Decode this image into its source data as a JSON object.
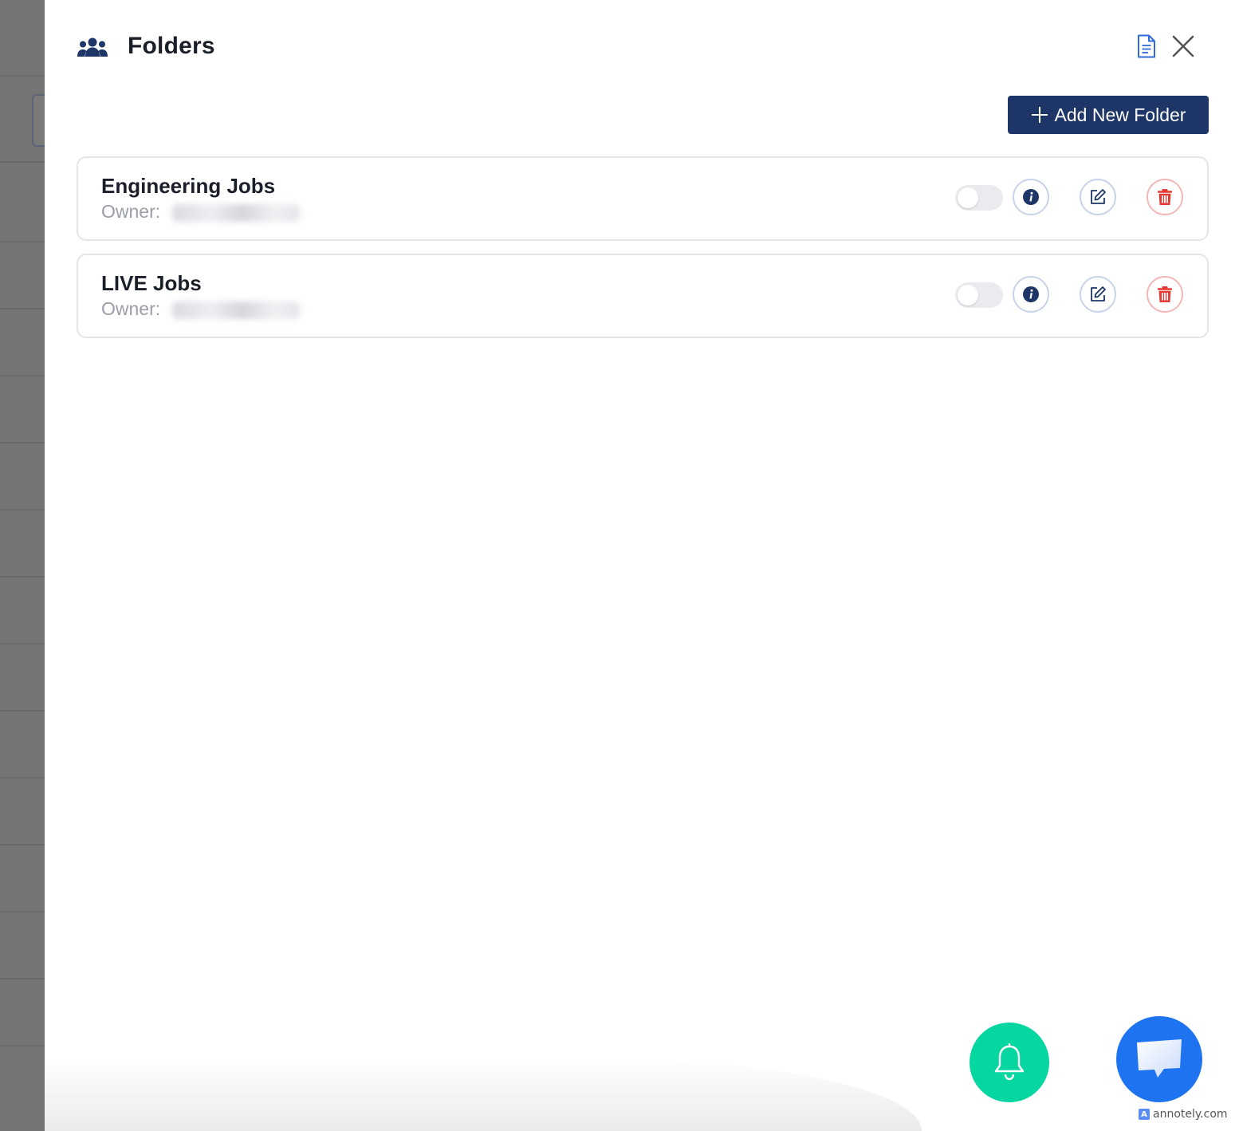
{
  "header": {
    "title": "Folders",
    "icon": "team-icon",
    "doc_icon": "document-icon",
    "close_icon": "close-icon"
  },
  "toolbar": {
    "add_folder_label": "Add New Folder"
  },
  "folders": [
    {
      "name": "Engineering Jobs",
      "owner_label": "Owner:",
      "owner_value_redacted": true,
      "enabled": false
    },
    {
      "name": "LIVE Jobs",
      "owner_label": "Owner:",
      "owner_value_redacted": true,
      "enabled": false
    }
  ],
  "fabs": {
    "bell": "bell-icon",
    "chat": "chat-icon"
  },
  "watermark": {
    "text": "annotely.com"
  },
  "colors": {
    "primary": "#1d3567",
    "danger": "#e53935",
    "bell_fab": "#06d6a0",
    "chat_fab": "#1e74f0"
  }
}
